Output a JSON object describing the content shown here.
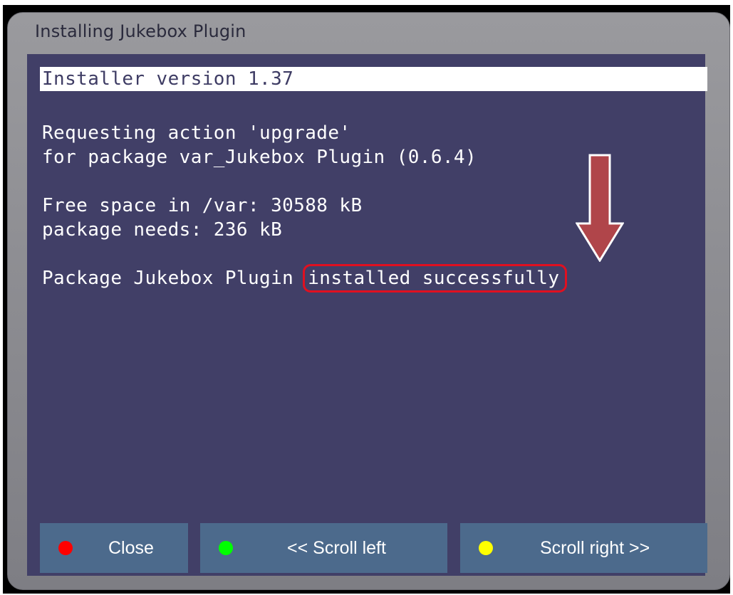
{
  "window": {
    "title": "Installing Jukebox Plugin"
  },
  "log": {
    "header": "Installer version 1.37",
    "lines": [
      "Requesting action 'upgrade'",
      "for package var_Jukebox Plugin (0.6.4)",
      "Free space in /var: 30588 kB",
      "package needs: 236 kB"
    ],
    "result_prefix": "Package Jukebox Plugin ",
    "result_status": "installed successfully"
  },
  "buttons": [
    {
      "label": "Close",
      "color": "#ff0000"
    },
    {
      "label": "<< Scroll left",
      "color": "#00ff00"
    },
    {
      "label": "Scroll right >>",
      "color": "#ffff00"
    }
  ],
  "colors": {
    "panel_bg": "#413f67",
    "button_bg": "#4c6a8c",
    "highlight": "#e01020",
    "arrow": "#b0454a"
  },
  "icons": {
    "annotation": "down-arrow-icon"
  }
}
